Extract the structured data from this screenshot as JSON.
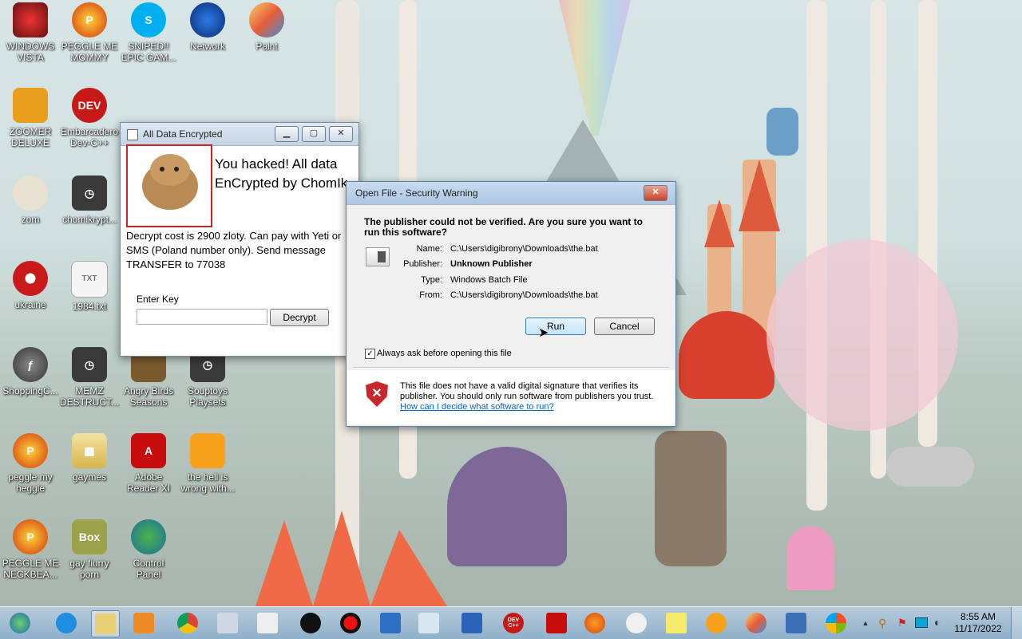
{
  "desktop_icons": [
    {
      "label": "WINDOWS\nVISTA",
      "icon": "vista-icon"
    },
    {
      "label": "PEGGLE ME\nMOMMY",
      "icon": "peggle-icon"
    },
    {
      "label": "SNIPED!!\nEPIC GAM...",
      "icon": "skype-icon"
    },
    {
      "label": "Network",
      "icon": "network-icon"
    },
    {
      "label": "Paint",
      "icon": "paint-icon"
    },
    {
      "label": "ZOOMER\nDELUXE",
      "icon": "zoomer-icon"
    },
    {
      "label": "Embarcadero\nDev-C++",
      "icon": "devcpp-icon"
    },
    {
      "label": "zom",
      "icon": "flower-icon"
    },
    {
      "label": "chomikrypt...",
      "icon": "clock-icon"
    },
    {
      "label": "ukraine",
      "icon": "radiation-icon"
    },
    {
      "label": "1984.txt",
      "icon": "text-file-icon"
    },
    {
      "label": "ShoppingC...",
      "icon": "flash-icon"
    },
    {
      "label": "MEMZ\nDESTRUCT...",
      "icon": "clock-icon"
    },
    {
      "label": "Angry Birds\nSeasons",
      "icon": "angry-birds-icon"
    },
    {
      "label": "Souptoys\nPlaysets",
      "icon": "clock-icon"
    },
    {
      "label": "peggle my\nheggle",
      "icon": "peggle-icon"
    },
    {
      "label": "gaymes",
      "icon": "folder-icon"
    },
    {
      "label": "Adobe\nReader XI",
      "icon": "adobe-icon"
    },
    {
      "label": "the hell is\nwrong with...",
      "icon": "uc-browser-icon"
    },
    {
      "label": "PEGGLE ME\nNECKBEA...",
      "icon": "peggle-icon"
    },
    {
      "label": "gay fiurry\nporn",
      "icon": "box-icon"
    },
    {
      "label": "Control\nPanel",
      "icon": "control-panel-icon"
    }
  ],
  "ransom_window": {
    "title": "All Data Encrypted",
    "headline": "You hacked! All data EnCrypted by ChomIk",
    "message": "Decrypt cost is 2900 zloty. Can pay with Yeti or SMS (Poland number only). Send message TRANSFER to 77038",
    "key_label": "Enter Key",
    "key_value": "",
    "decrypt_button": "Decrypt"
  },
  "security_dialog": {
    "title": "Open File - Security Warning",
    "question": "The publisher could not be verified.  Are you sure you want to run this software?",
    "fields": [
      {
        "label": "Name:",
        "value": "C:\\Users\\digibrony\\Downloads\\the.bat"
      },
      {
        "label": "Publisher:",
        "value": "Unknown Publisher"
      },
      {
        "label": "Type:",
        "value": "Windows Batch File"
      },
      {
        "label": "From:",
        "value": "C:\\Users\\digibrony\\Downloads\\the.bat"
      }
    ],
    "run_button": "Run",
    "cancel_button": "Cancel",
    "checkbox_label": "Always ask before opening this file",
    "checkbox_checked": true,
    "warning_text": "This file does not have a valid digital signature that verifies its publisher.  You should only run software from publishers you trust.",
    "help_link": "How can I decide what software to run?"
  },
  "taskbar": {
    "pinned": [
      "start-orb-icon",
      "internet-explorer-icon",
      "file-explorer-icon",
      "media-player-icon",
      "chrome-icon",
      "calculator-icon",
      "solitaire-icon",
      "memz-icon",
      "record-icon",
      "network-icon",
      "document-icon",
      "remote-desktop-icon",
      "devcpp-icon",
      "adobe-icon",
      "firefox-icon",
      "snipping-icon",
      "sticky-notes-icon",
      "uc-browser-icon",
      "paint-icon",
      "virtualbox-icon",
      "windows-logo-icon"
    ],
    "devcpp_text": "DEV\nC++",
    "clock_time": "8:55 AM",
    "clock_date": "11/17/2022"
  },
  "colors": {
    "dialog_link": "#0066cc",
    "shield_red": "#c8282d",
    "taskbar": "#9fbbd2"
  }
}
